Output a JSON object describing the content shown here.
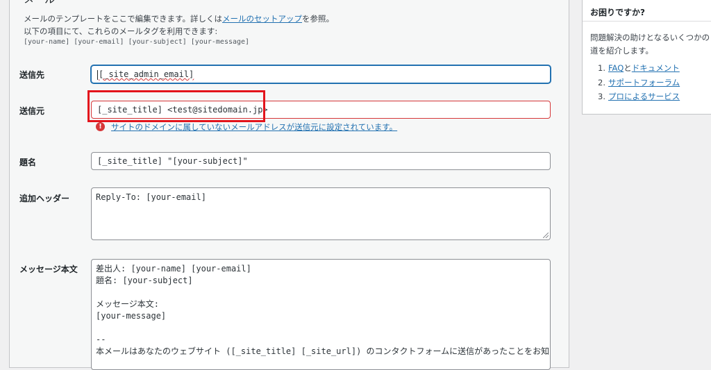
{
  "section": {
    "heading": "メール",
    "desc_prefix": "メールのテンプレートをここで編集できます。詳しくは",
    "desc_link": "メールのセットアップ",
    "desc_suffix": "を参照。",
    "desc_line2": "以下の項目にて、これらのメールタグを利用できます:",
    "mail_tags": [
      "[your-name]",
      "[your-email]",
      "[your-subject]",
      "[your-message]"
    ]
  },
  "fields": {
    "to": {
      "label": "送信先",
      "value": "[_site_admin_email]"
    },
    "from": {
      "label": "送信元",
      "value": "[_site_title] <test@sitedomain.jp>",
      "error_icon": "!",
      "error": "サイトのドメインに属していないメールアドレスが送信元に設定されています。"
    },
    "subject": {
      "label": "題名",
      "value": "[_site_title] \"[your-subject]\""
    },
    "headers": {
      "label": "追加ヘッダー",
      "value": "Reply-To: [your-email]"
    },
    "body": {
      "label": "メッセージ本文",
      "value": "差出人: [your-name] [your-email]\n題名: [your-subject]\n\nメッセージ本文:\n[your-message]\n\n-- \n本メールはあなたのウェブサイト ([_site_title] [_site_url]) のコンタクトフォームに送信があったことをお知ら"
    }
  },
  "sidebar": {
    "title": "お困りですか?",
    "desc": "問題解決の助けとなるいくつかの道を紹介します。",
    "items": [
      {
        "num": "1.",
        "link1": "FAQ",
        "joiner": "と",
        "link2": "ドキュメント"
      },
      {
        "num": "2.",
        "link1": "サポートフォーラム"
      },
      {
        "num": "3.",
        "link1": "プロによるサービス"
      }
    ]
  },
  "colors": {
    "link": "#2271b1",
    "error": "#d63638",
    "highlight": "#e3141c",
    "focus": "#2271b1"
  }
}
